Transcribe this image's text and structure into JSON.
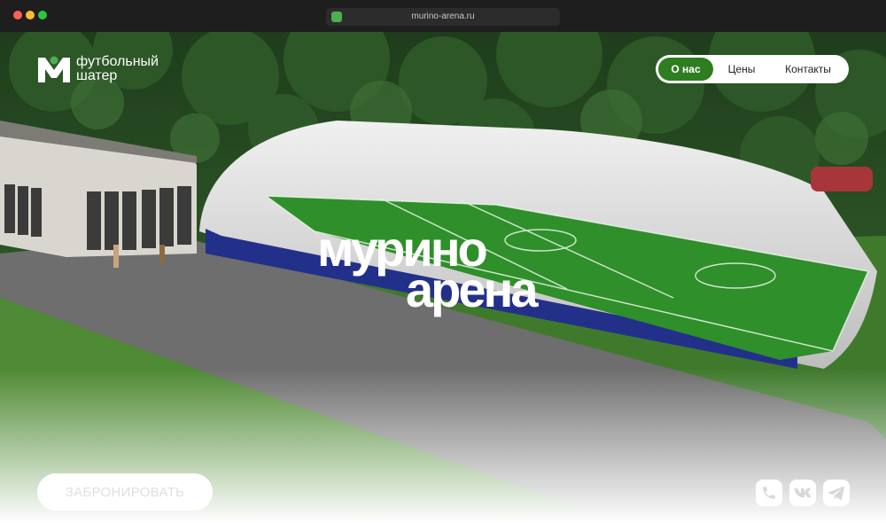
{
  "browser": {
    "url": "murino-arena.ru"
  },
  "logo": {
    "mark": "M",
    "line1": "футбольный",
    "line2": "шатер"
  },
  "nav": {
    "items": [
      {
        "label": "О нас",
        "active": true
      },
      {
        "label": "Цены",
        "active": false
      },
      {
        "label": "Контакты",
        "active": false
      }
    ]
  },
  "hero": {
    "title_line1": "мурино",
    "title_line2": "арена"
  },
  "cta": {
    "book_label": "ЗАБРОНИРОВАТЬ"
  },
  "social": {
    "icons": [
      "phone-icon",
      "vk-icon",
      "telegram-icon"
    ]
  },
  "colors": {
    "accent": "#2e7d1f",
    "field": "#2f8f2a",
    "dome": "#dcdcdc"
  }
}
